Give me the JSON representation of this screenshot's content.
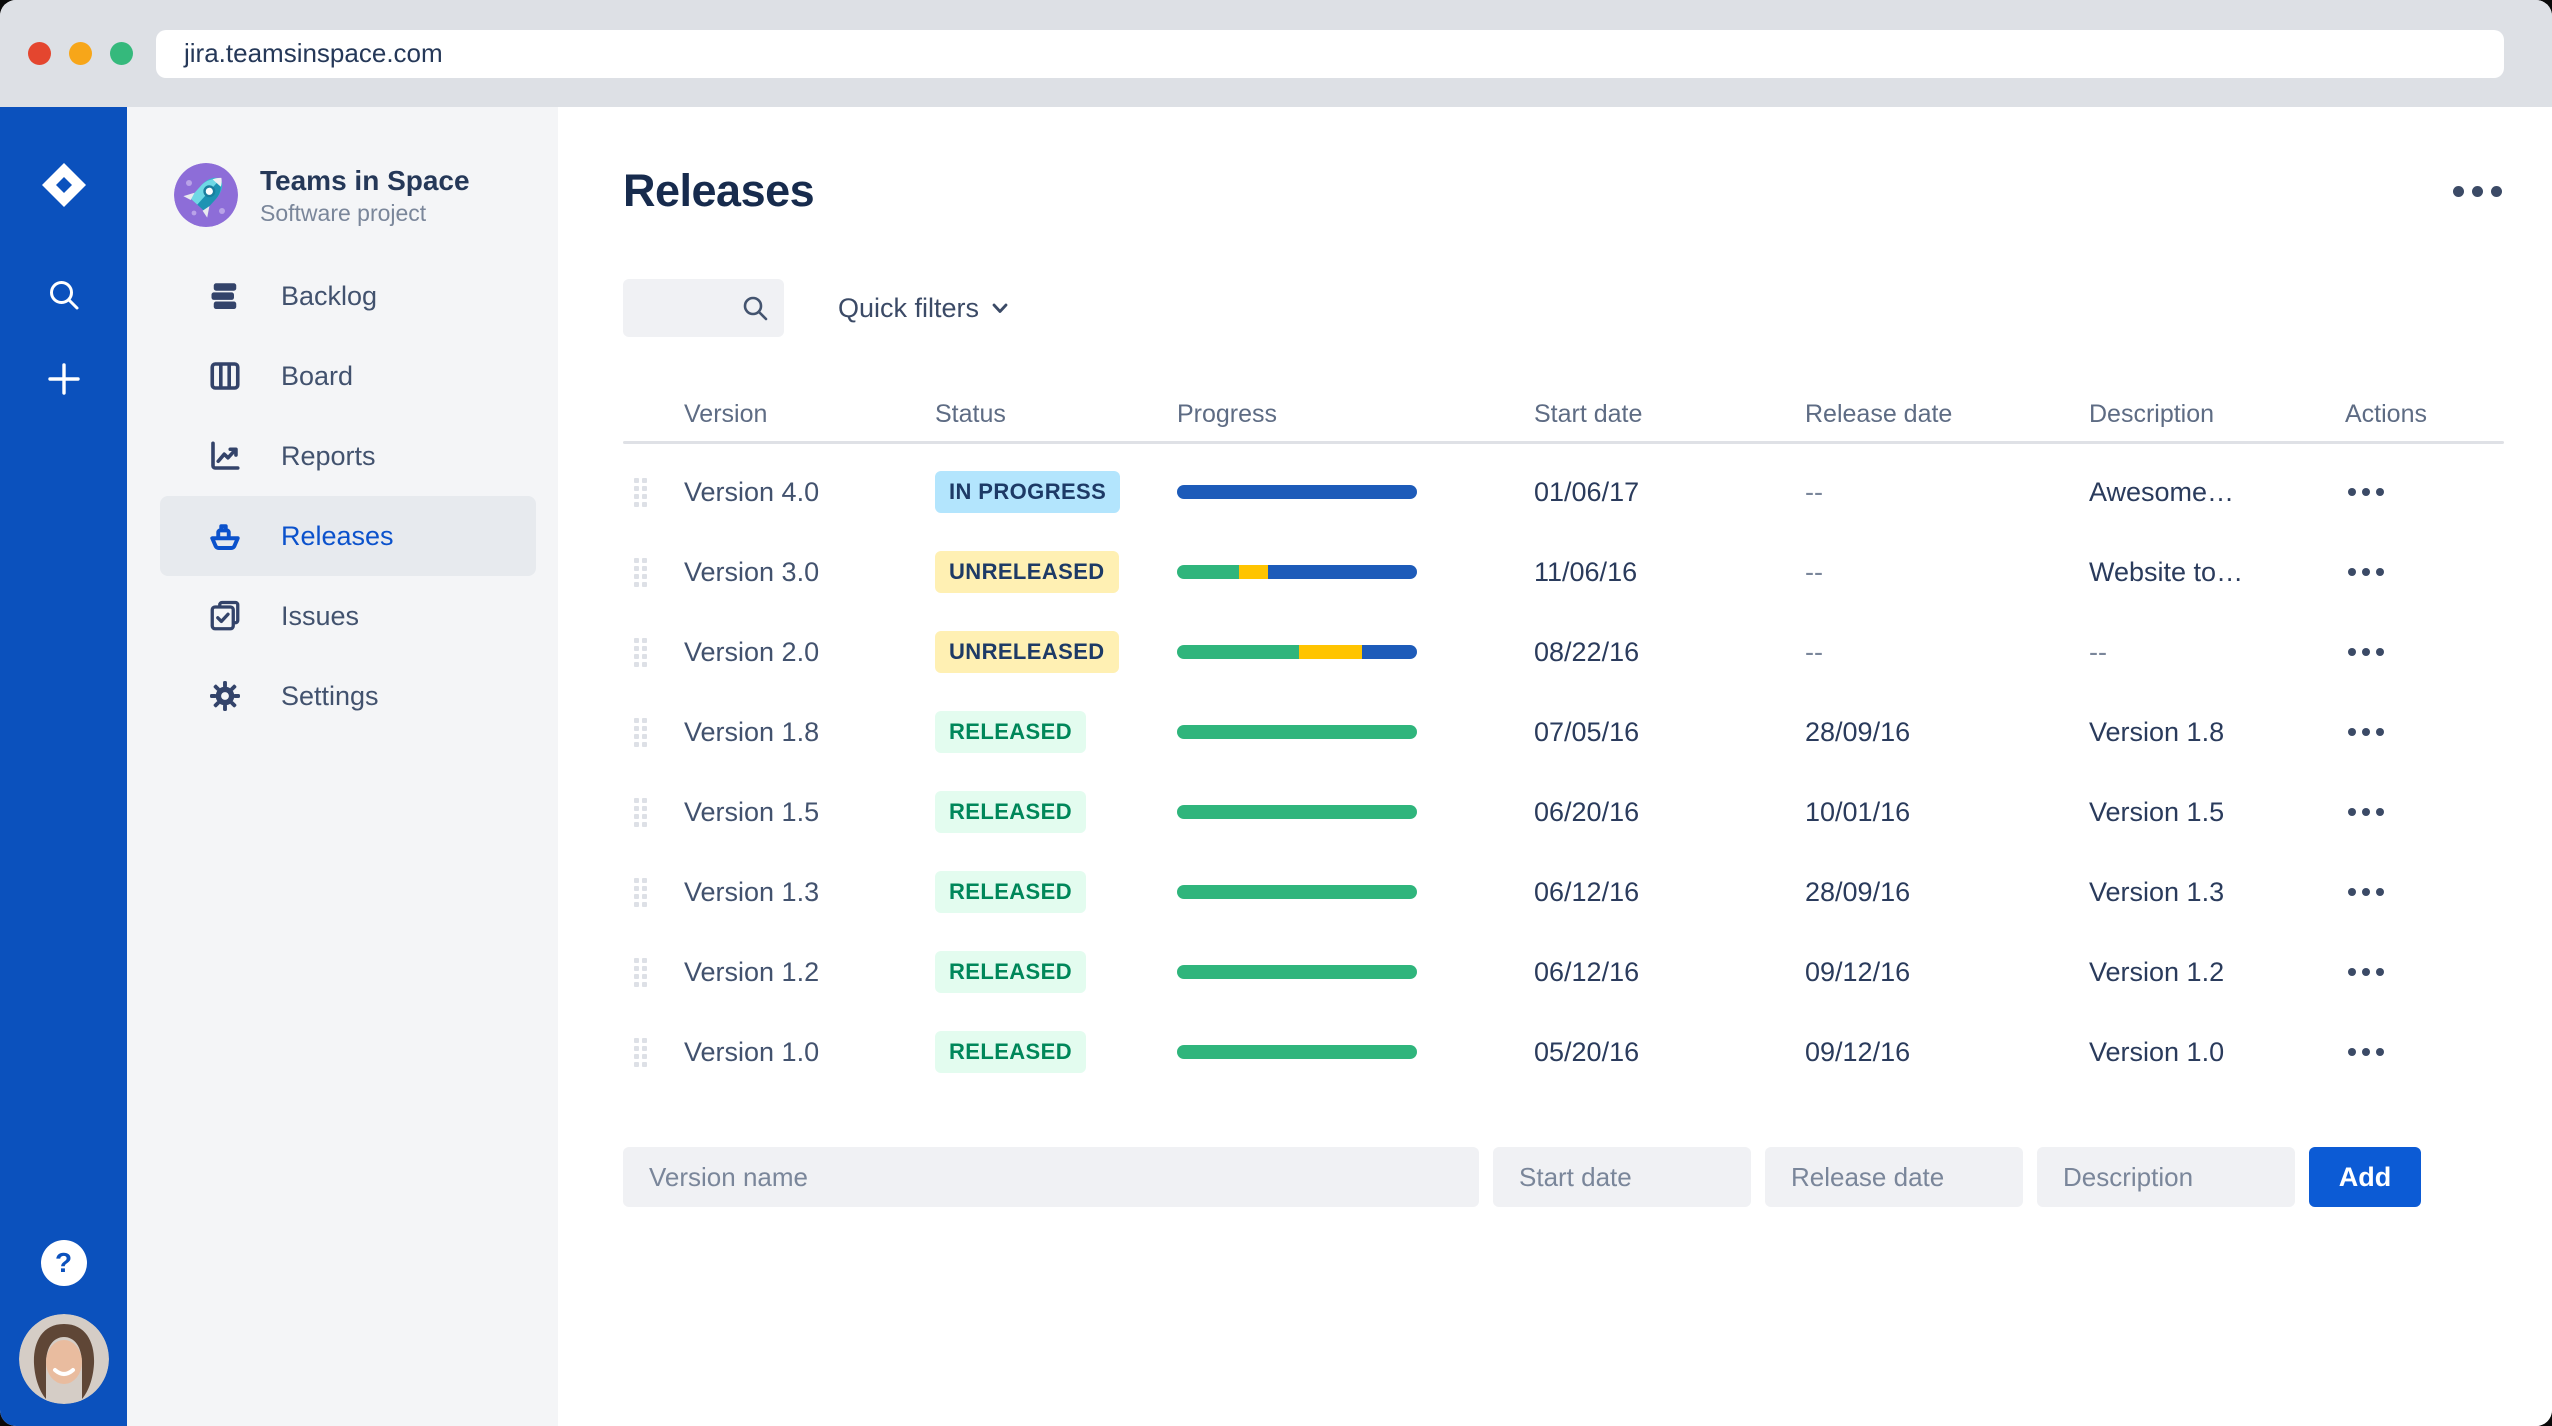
{
  "browser": {
    "url": "jira.teamsinspace.com"
  },
  "sidebar": {
    "project_name": "Teams in Space",
    "project_type": "Software project",
    "items": [
      {
        "label": "Backlog",
        "icon": "backlog-icon",
        "selected": false
      },
      {
        "label": "Board",
        "icon": "board-icon",
        "selected": false
      },
      {
        "label": "Reports",
        "icon": "reports-icon",
        "selected": false
      },
      {
        "label": "Releases",
        "icon": "ship-icon",
        "selected": true
      },
      {
        "label": "Issues",
        "icon": "issues-icon",
        "selected": false
      },
      {
        "label": "Settings",
        "icon": "gear-icon",
        "selected": false
      }
    ]
  },
  "main": {
    "title": "Releases",
    "toolbar": {
      "search_placeholder": "",
      "quick_filters_label": "Quick filters"
    },
    "table": {
      "columns": [
        "Version",
        "Status",
        "Progress",
        "Start date",
        "Release date",
        "Description",
        "Actions"
      ],
      "rows": [
        {
          "name": "Version 4.0",
          "status": "IN PROGRESS",
          "status_type": "in-progress",
          "segments": [
            {
              "color": "blue",
              "pct": 100
            }
          ],
          "start_date": "01/06/17",
          "release_date": "--",
          "description": "Awesome…"
        },
        {
          "name": "Version 3.0",
          "status": "UNRELEASED",
          "status_type": "unreleased",
          "segments": [
            {
              "color": "green",
              "pct": 26
            },
            {
              "color": "yellow",
              "pct": 12
            },
            {
              "color": "blue",
              "pct": 62
            }
          ],
          "start_date": "11/06/16",
          "release_date": "--",
          "description": "Website to…"
        },
        {
          "name": "Version 2.0",
          "status": "UNRELEASED",
          "status_type": "unreleased",
          "segments": [
            {
              "color": "green",
              "pct": 51
            },
            {
              "color": "yellow",
              "pct": 26
            },
            {
              "color": "blue",
              "pct": 23
            }
          ],
          "start_date": "08/22/16",
          "release_date": "--",
          "description": "--"
        },
        {
          "name": "Version 1.8",
          "status": "RELEASED",
          "status_type": "released",
          "segments": [
            {
              "color": "green",
              "pct": 100
            }
          ],
          "start_date": "07/05/16",
          "release_date": "28/09/16",
          "description": "Version 1.8"
        },
        {
          "name": "Version 1.5",
          "status": "RELEASED",
          "status_type": "released",
          "segments": [
            {
              "color": "green",
              "pct": 100
            }
          ],
          "start_date": "06/20/16",
          "release_date": "10/01/16",
          "description": "Version 1.5"
        },
        {
          "name": "Version 1.3",
          "status": "RELEASED",
          "status_type": "released",
          "segments": [
            {
              "color": "green",
              "pct": 100
            }
          ],
          "start_date": "06/12/16",
          "release_date": "28/09/16",
          "description": "Version 1.3"
        },
        {
          "name": "Version 1.2",
          "status": "RELEASED",
          "status_type": "released",
          "segments": [
            {
              "color": "green",
              "pct": 100
            }
          ],
          "start_date": "06/12/16",
          "release_date": "09/12/16",
          "description": "Version 1.2"
        },
        {
          "name": "Version 1.0",
          "status": "RELEASED",
          "status_type": "released",
          "segments": [
            {
              "color": "green",
              "pct": 100
            }
          ],
          "start_date": "05/20/16",
          "release_date": "09/12/16",
          "description": "Version 1.0"
        }
      ]
    },
    "form": {
      "version_placeholder": "Version name",
      "start_placeholder": "Start date",
      "release_placeholder": "Release date",
      "description_placeholder": "Description",
      "add_label": "Add"
    }
  },
  "colors": {
    "rail_blue": "#0B51BD",
    "accent_blue": "#0C5BD5",
    "progress": {
      "green": "#2FB57C",
      "yellow": "#FFC400",
      "blue": "#1D5BB9"
    },
    "badge": {
      "in_progress_bg": "#B3E5FD",
      "unreleased_bg": "#FFF0B3",
      "released_bg": "#E3FCEF",
      "released_text": "#00875A"
    }
  }
}
